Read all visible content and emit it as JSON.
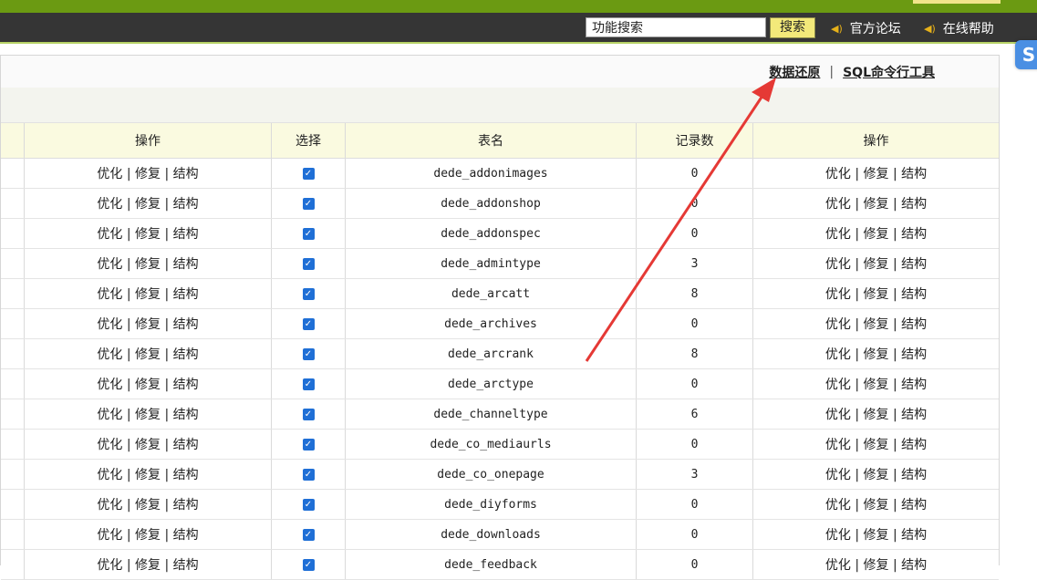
{
  "header": {
    "search_placeholder": "功能搜索",
    "search_button": "搜索",
    "links": [
      {
        "label": "官方论坛"
      },
      {
        "label": "在线帮助"
      }
    ],
    "widget_letter": "S"
  },
  "toolbar": {
    "restore_label": "数据还原",
    "separator": "|",
    "sql_label": "SQL命令行工具"
  },
  "table": {
    "headers": [
      "操作",
      "选择",
      "表名",
      "记录数",
      "操作"
    ],
    "op_text": "优化 | 修复 | 结构",
    "rows": [
      {
        "table": "dede_addonimages",
        "count": "0"
      },
      {
        "table": "dede_addonshop",
        "count": "0"
      },
      {
        "table": "dede_addonspec",
        "count": "0"
      },
      {
        "table": "dede_admintype",
        "count": "3"
      },
      {
        "table": "dede_arcatt",
        "count": "8"
      },
      {
        "table": "dede_archives",
        "count": "0"
      },
      {
        "table": "dede_arcrank",
        "count": "8"
      },
      {
        "table": "dede_arctype",
        "count": "0"
      },
      {
        "table": "dede_channeltype",
        "count": "6"
      },
      {
        "table": "dede_co_mediaurls",
        "count": "0"
      },
      {
        "table": "dede_co_onepage",
        "count": "3"
      },
      {
        "table": "dede_diyforms",
        "count": "0"
      },
      {
        "table": "dede_downloads",
        "count": "0"
      },
      {
        "table": "dede_feedback",
        "count": "0"
      }
    ]
  },
  "colors": {
    "top_green": "#6b9a12",
    "top_dark": "#353535",
    "header_row": "#fafae0",
    "checkbox": "#1f6fd6",
    "arrow": "#e53935"
  }
}
